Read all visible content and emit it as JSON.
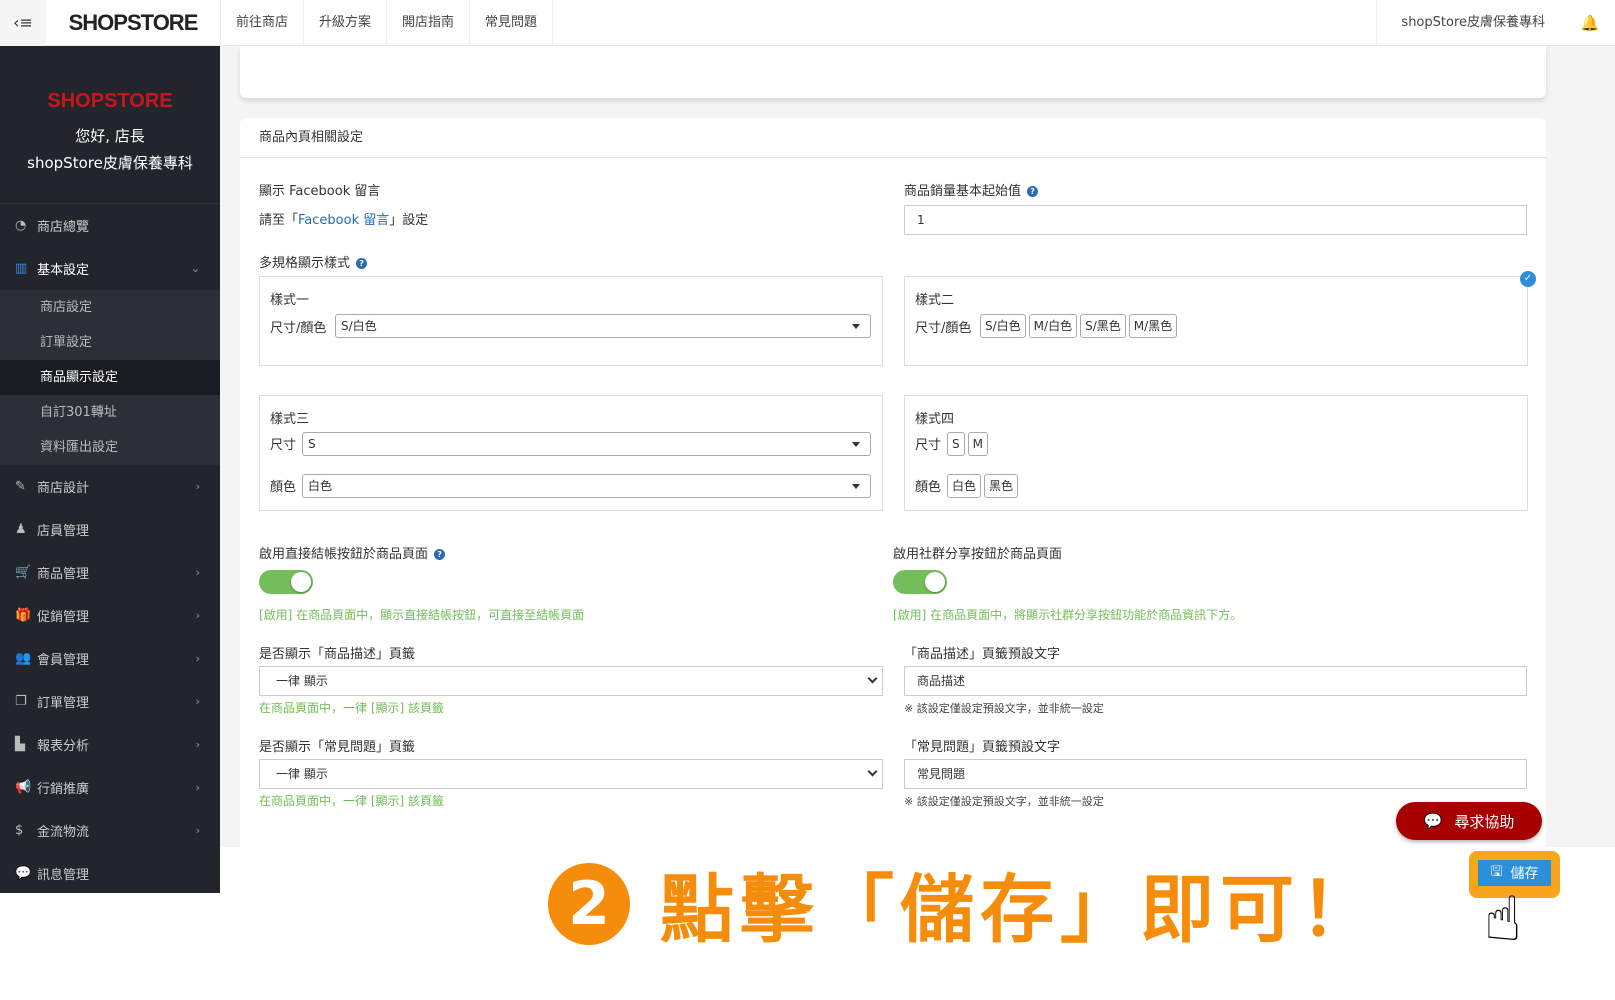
{
  "header": {
    "logo": "SHOPSTORE",
    "nav": [
      "前往商店",
      "升級方案",
      "開店指南",
      "常見問題"
    ],
    "store_name": "shopStore皮膚保養專科"
  },
  "sidebar": {
    "logo": "SHOPSTORE",
    "greeting": "您好, 店長",
    "store": "shopStore皮膚保養專科",
    "items": [
      {
        "label": "商店總覽",
        "icon": "dashboard-icon"
      },
      {
        "label": "基本設定",
        "icon": "bank-icon"
      },
      {
        "label": "商店設計",
        "icon": "magic-wand-icon"
      },
      {
        "label": "店員管理",
        "icon": "user-icon"
      },
      {
        "label": "商品管理",
        "icon": "cart-icon"
      },
      {
        "label": "促銷管理",
        "icon": "gift-icon"
      },
      {
        "label": "會員管理",
        "icon": "users-icon"
      },
      {
        "label": "訂單管理",
        "icon": "copy-icon"
      },
      {
        "label": "報表分析",
        "icon": "bar-chart-icon"
      },
      {
        "label": "行銷推廣",
        "icon": "bullhorn-icon"
      },
      {
        "label": "金流物流",
        "icon": "dollar-icon"
      },
      {
        "label": "訊息管理",
        "icon": "comments-icon"
      }
    ],
    "sub_items": [
      "商店設定",
      "訂單設定",
      "商品顯示設定",
      "自訂301轉址",
      "資料匯出設定"
    ]
  },
  "card": {
    "title": "商品內頁相關設定",
    "fb_label": "顯示 Facebook 留言",
    "fb_pre": "請至「",
    "fb_link": "Facebook 留言",
    "fb_post": "」設定",
    "sales_label": "商品銷量基本起始值",
    "sales_value": "1",
    "variant_label": "多規格顯示樣式",
    "style1": {
      "title": "樣式一",
      "field": "尺寸/顏色",
      "value": "S/白色"
    },
    "style2": {
      "title": "樣式二",
      "field": "尺寸/顏色",
      "chips": [
        "S/白色",
        "M/白色",
        "S/黑色",
        "M/黑色"
      ]
    },
    "style3": {
      "title": "樣式三",
      "size_label": "尺寸",
      "size_value": "S",
      "color_label": "顏色",
      "color_value": "白色"
    },
    "style4": {
      "title": "樣式四",
      "size_label": "尺寸",
      "sizes": [
        "S",
        "M"
      ],
      "color_label": "顏色",
      "colors": [
        "白色",
        "黑色"
      ]
    },
    "checkout_label": "啟用直接結帳按鈕於商品頁面",
    "checkout_on": true,
    "checkout_help": "[啟用] 在商品頁面中，顯示直接結帳按鈕，可直接至結帳頁面",
    "share_label": "啟用社群分享按鈕於商品頁面",
    "share_on": true,
    "share_help": "[啟用] 在商品頁面中，將顯示社群分享按鈕功能於商品資訊下方。",
    "desc_tab_label": "是否顯示「商品描述」頁籤",
    "desc_tab_value": "一律 顯示",
    "desc_tab_help": "在商品頁面中，一律 [顯示] 該頁籤",
    "desc_text_label": "「商品描述」頁籤預設文字",
    "desc_text_value": "商品描述",
    "desc_text_note": "※ 該設定僅設定預設文字，並非統一設定",
    "faq_tab_label": "是否顯示「常見問題」頁籤",
    "faq_tab_value": "一律 顯示",
    "faq_tab_help": "在商品頁面中，一律 [顯示] 該頁籤",
    "faq_text_label": "「常見問題」頁籤預設文字",
    "faq_text_value": "常見問題",
    "faq_text_note": "※ 該設定僅設定預設文字，並非統一設定"
  },
  "help_button": "尋求協助",
  "save_button": "儲存",
  "annotation": {
    "step": "2",
    "text": "點擊「儲存」即可！"
  },
  "colors": {
    "sidebar": "#22252c",
    "toggle": "#73bd5a",
    "help": "#a80000",
    "save": "#2d8fd9",
    "annotation": "#f58c0b"
  }
}
